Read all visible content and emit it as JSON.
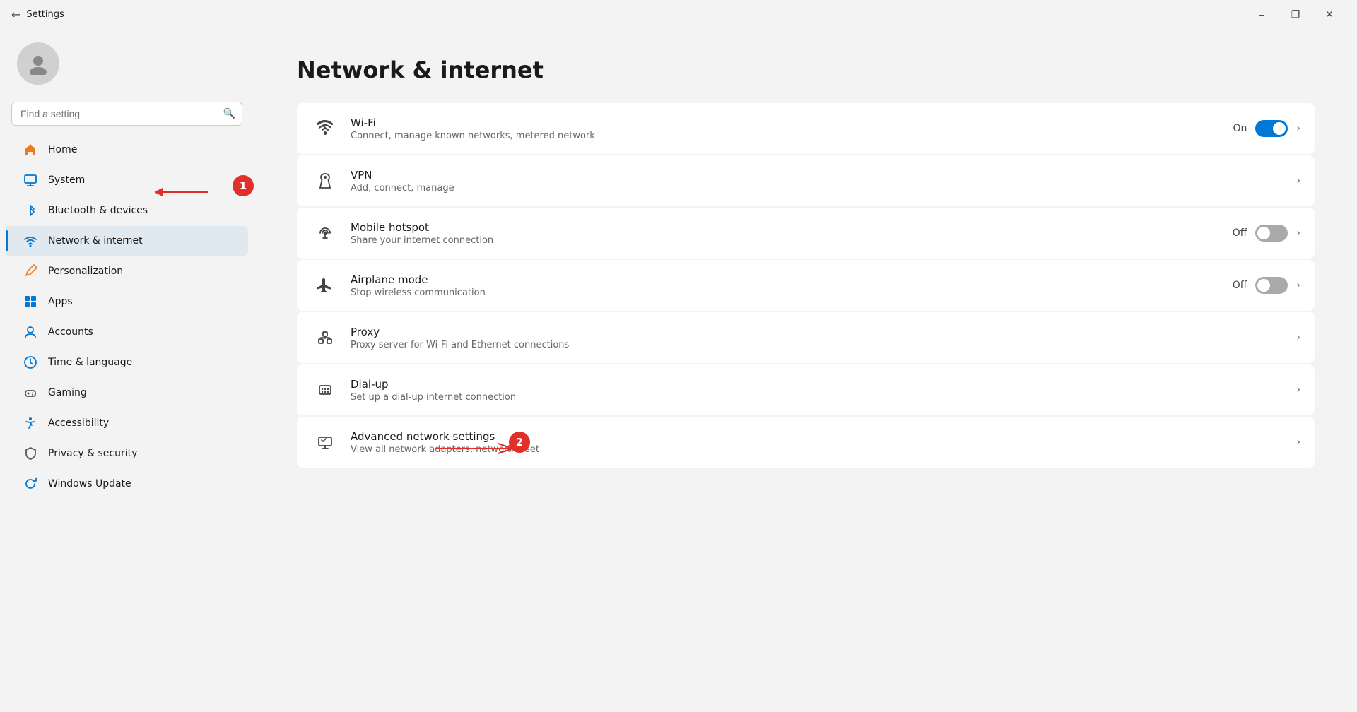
{
  "titleBar": {
    "appName": "Settings",
    "minimize": "–",
    "maximize": "❐",
    "close": "✕"
  },
  "sidebar": {
    "searchPlaceholder": "Find a setting",
    "navItems": [
      {
        "id": "home",
        "label": "Home",
        "icon": "🏠",
        "iconColor": "#e87c1e",
        "active": false
      },
      {
        "id": "system",
        "label": "System",
        "icon": "💻",
        "iconColor": "#0078d4",
        "active": false
      },
      {
        "id": "bluetooth",
        "label": "Bluetooth & devices",
        "icon": "⬡",
        "iconColor": "#0078d4",
        "active": false
      },
      {
        "id": "network",
        "label": "Network & internet",
        "icon": "◈",
        "iconColor": "#0078d4",
        "active": true
      },
      {
        "id": "personalization",
        "label": "Personalization",
        "icon": "✏",
        "iconColor": "#e87c1e",
        "active": false
      },
      {
        "id": "apps",
        "label": "Apps",
        "icon": "⬛",
        "iconColor": "#0078d4",
        "active": false
      },
      {
        "id": "accounts",
        "label": "Accounts",
        "icon": "👤",
        "iconColor": "#0078d4",
        "active": false
      },
      {
        "id": "time",
        "label": "Time & language",
        "icon": "🌐",
        "iconColor": "#0078d4",
        "active": false
      },
      {
        "id": "gaming",
        "label": "Gaming",
        "icon": "🎮",
        "iconColor": "#555",
        "active": false
      },
      {
        "id": "accessibility",
        "label": "Accessibility",
        "icon": "♿",
        "iconColor": "#0078d4",
        "active": false
      },
      {
        "id": "privacy",
        "label": "Privacy & security",
        "icon": "🛡",
        "iconColor": "#555",
        "active": false
      },
      {
        "id": "windowsupdate",
        "label": "Windows Update",
        "icon": "🔄",
        "iconColor": "#0078d4",
        "active": false
      }
    ]
  },
  "main": {
    "pageTitle": "Network & internet",
    "items": [
      {
        "id": "wifi",
        "icon": "wifi",
        "title": "Wi-Fi",
        "desc": "Connect, manage known networks, metered network",
        "hasToggle": true,
        "toggleState": "on",
        "toggleLabel": "On",
        "hasChevron": true
      },
      {
        "id": "vpn",
        "icon": "vpn",
        "title": "VPN",
        "desc": "Add, connect, manage",
        "hasToggle": false,
        "toggleState": "",
        "toggleLabel": "",
        "hasChevron": true
      },
      {
        "id": "hotspot",
        "icon": "hotspot",
        "title": "Mobile hotspot",
        "desc": "Share your internet connection",
        "hasToggle": true,
        "toggleState": "off",
        "toggleLabel": "Off",
        "hasChevron": true
      },
      {
        "id": "airplane",
        "icon": "airplane",
        "title": "Airplane mode",
        "desc": "Stop wireless communication",
        "hasToggle": true,
        "toggleState": "off",
        "toggleLabel": "Off",
        "hasChevron": true
      },
      {
        "id": "proxy",
        "icon": "proxy",
        "title": "Proxy",
        "desc": "Proxy server for Wi-Fi and Ethernet connections",
        "hasToggle": false,
        "toggleState": "",
        "toggleLabel": "",
        "hasChevron": true
      },
      {
        "id": "dialup",
        "icon": "dialup",
        "title": "Dial-up",
        "desc": "Set up a dial-up internet connection",
        "hasToggle": false,
        "toggleState": "",
        "toggleLabel": "",
        "hasChevron": true
      },
      {
        "id": "advanced",
        "icon": "advanced",
        "title": "Advanced network settings",
        "desc": "View all network adapters, network reset",
        "hasToggle": false,
        "toggleState": "",
        "toggleLabel": "",
        "hasChevron": true
      }
    ]
  },
  "annotations": {
    "one": "1",
    "two": "2"
  }
}
